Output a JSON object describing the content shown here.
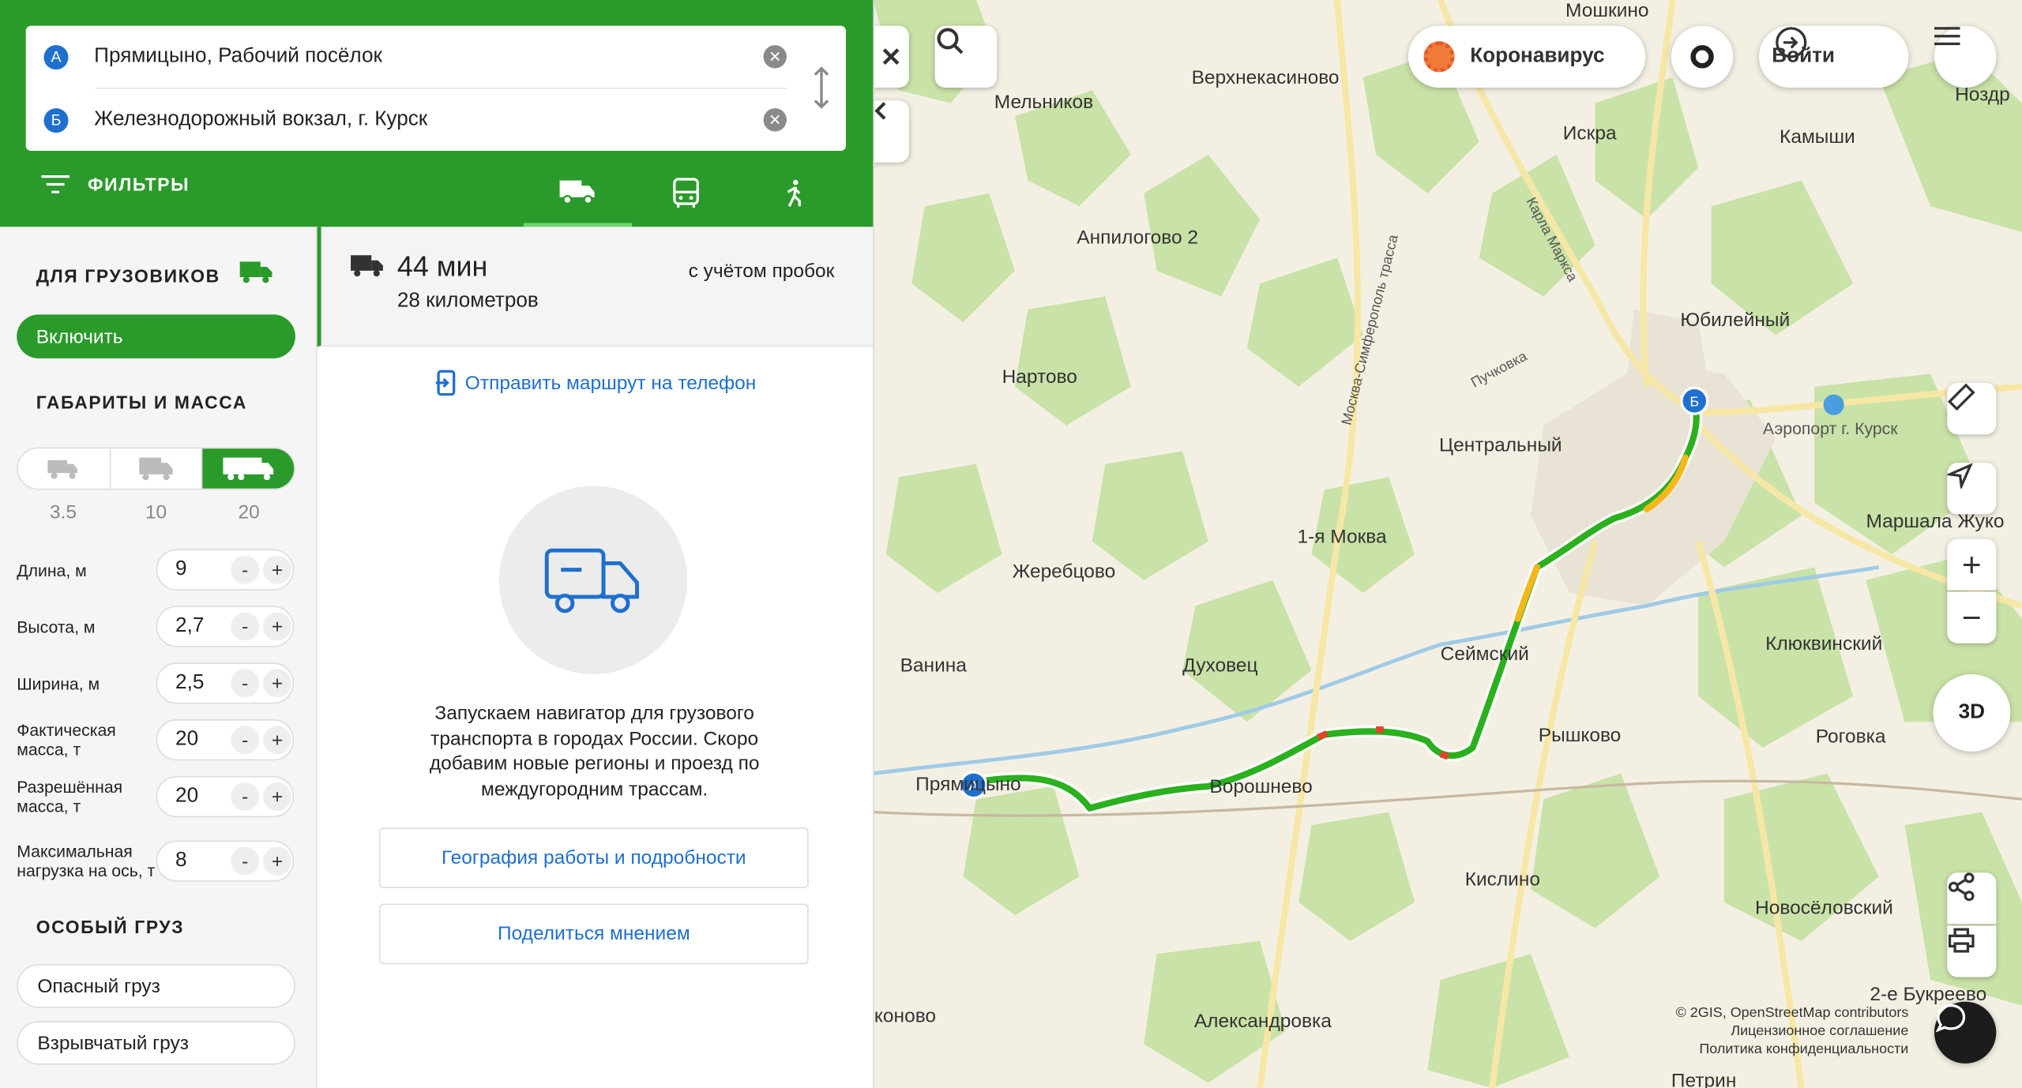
{
  "route": {
    "from": "Прямицыно, Рабочий посёлок",
    "to": "Железнодорожный вокзал, г. Курск",
    "from_badge": "А",
    "to_badge": "Б",
    "filters_label": "ФИЛЬТРЫ",
    "modes": [
      "truck-icon",
      "bus-icon",
      "pedestrian-icon"
    ],
    "active_mode": "truck"
  },
  "trucks": {
    "title": "ДЛЯ ГРУЗОВИКОВ",
    "enable_label": "Включить",
    "dims_title": "ГАБАРИТЫ И МАССА",
    "weights": [
      "3.5",
      "10",
      "20"
    ],
    "selected_weight": "20",
    "params": [
      {
        "label": "Длина, м",
        "value": "9"
      },
      {
        "label": "Высота, м",
        "value": "2,7"
      },
      {
        "label": "Ширина, м",
        "value": "2,5"
      },
      {
        "label": "Фактическая масса, т",
        "value": "20"
      },
      {
        "label": "Разрешённая масса, т",
        "value": "20"
      },
      {
        "label": "Максимальная нагрузка на ось, т",
        "value": "8"
      }
    ],
    "minus": "-",
    "plus": "+",
    "special_title": "ОСОБЫЙ ГРУЗ",
    "cargo": [
      "Опасный груз",
      "Взрывчатый груз"
    ]
  },
  "summary": {
    "duration": "44 мин",
    "distance": "28 километров",
    "traffic_note": "с учётом пробок"
  },
  "main": {
    "send_link": "Отправить маршрут на телефон",
    "info": "Запускаем навигатор для грузового транспорта в городах России. Скоро добавим новые регионы и проезд по междугородним трассам.",
    "geo_button": "География работы и подробности",
    "feedback_button": "Поделиться мнением"
  },
  "map": {
    "covid_label": "Коронавирус",
    "login_label": "Войти",
    "button_3d": "3D",
    "places": [
      {
        "name": "Мошкино"
      },
      {
        "name": "Мельников"
      },
      {
        "name": "Верхнекасиново"
      },
      {
        "name": "Искра"
      },
      {
        "name": "Камыши"
      },
      {
        "name": "Ноздр"
      },
      {
        "name": "Анпилогово 2"
      },
      {
        "name": "Юбилейный"
      },
      {
        "name": "Нартово"
      },
      {
        "name": "Центральный"
      },
      {
        "name": "1-я Моква"
      },
      {
        "name": "Маршала Жуко"
      },
      {
        "name": "Жеребцово"
      },
      {
        "name": "Ванина"
      },
      {
        "name": "Духовец"
      },
      {
        "name": "Сеймский"
      },
      {
        "name": "Клюквинский"
      },
      {
        "name": "Рышково"
      },
      {
        "name": "Роговка"
      },
      {
        "name": "Прямицыно"
      },
      {
        "name": "Ворошнево"
      },
      {
        "name": "Кислино"
      },
      {
        "name": "Новосёловский"
      },
      {
        "name": "2-е Букреево"
      },
      {
        "name": "коново"
      },
      {
        "name": "Александровка"
      },
      {
        "name": "Петрин"
      }
    ],
    "road_labels": [
      "Москва-Симферополь трасса",
      "Карла Маркса",
      "Пучковка"
    ],
    "airport": "Аэропорт г. Курск",
    "attribution": [
      "© 2GIS, OpenStreetMap contributors",
      "Лицензионное соглашение",
      "Политика конфиденциальности"
    ],
    "colors": {
      "route_green": "#2bb01e",
      "route_yellow": "#f3b81a",
      "route_red": "#e5432b",
      "forest": "#c8e2a8",
      "water": "#aad3ea",
      "brand": "#2a9a2a"
    }
  }
}
